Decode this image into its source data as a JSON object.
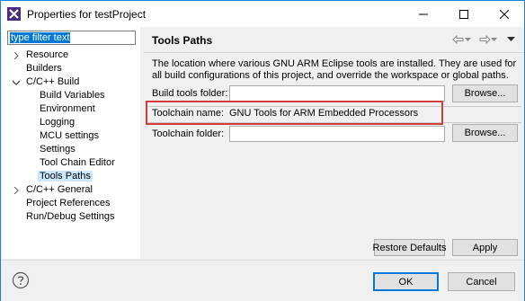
{
  "window": {
    "title": "Properties for testProject",
    "app_icon": "eclipse-x-icon"
  },
  "titlebar_buttons": {
    "minimize_icon": "minimize-icon",
    "maximize_icon": "maximize-icon",
    "close_icon": "close-icon"
  },
  "filter": {
    "value": "type filter text"
  },
  "tree": {
    "items": [
      {
        "label": "Resource",
        "expander": "collapsed"
      },
      {
        "label": "Builders",
        "expander": "none"
      },
      {
        "label": "C/C++ Build",
        "expander": "expanded"
      },
      {
        "label": "Build Variables",
        "expander": "none"
      },
      {
        "label": "Environment",
        "expander": "none"
      },
      {
        "label": "Logging",
        "expander": "none"
      },
      {
        "label": "MCU settings",
        "expander": "none"
      },
      {
        "label": "Settings",
        "expander": "none"
      },
      {
        "label": "Tool Chain Editor",
        "expander": "none"
      },
      {
        "label": "Tools Paths",
        "expander": "none",
        "selected": true
      },
      {
        "label": "C/C++ General",
        "expander": "collapsed"
      },
      {
        "label": "Project References",
        "expander": "none"
      },
      {
        "label": "Run/Debug Settings",
        "expander": "none"
      }
    ]
  },
  "page": {
    "title": "Tools Paths",
    "nav": {
      "back_icon": "back-arrow-icon",
      "forward_icon": "forward-arrow-icon",
      "menu_icon": "view-menu-icon"
    },
    "description": "The location where various GNU ARM Eclipse tools are installed. They are used for all build configurations of this project, and override the workspace or global paths.",
    "build_tools_folder": {
      "label": "Build tools folder:",
      "value": "",
      "browse_label": "Browse..."
    },
    "toolchain_name": {
      "label": "Toolchain name:",
      "value": "GNU Tools for ARM Embedded Processors"
    },
    "toolchain_folder": {
      "label": "Toolchain folder:",
      "value": "",
      "browse_label": "Browse..."
    },
    "restore_defaults_label": "Restore Defaults",
    "apply_label": "Apply"
  },
  "footer": {
    "help_icon": "help-icon",
    "ok_label": "OK",
    "cancel_label": "Cancel"
  },
  "colors": {
    "window_border": "#1883d7",
    "selection": "#0078d7",
    "tree_selection": "#cce8ff",
    "highlight_box": "#d43c3c"
  }
}
